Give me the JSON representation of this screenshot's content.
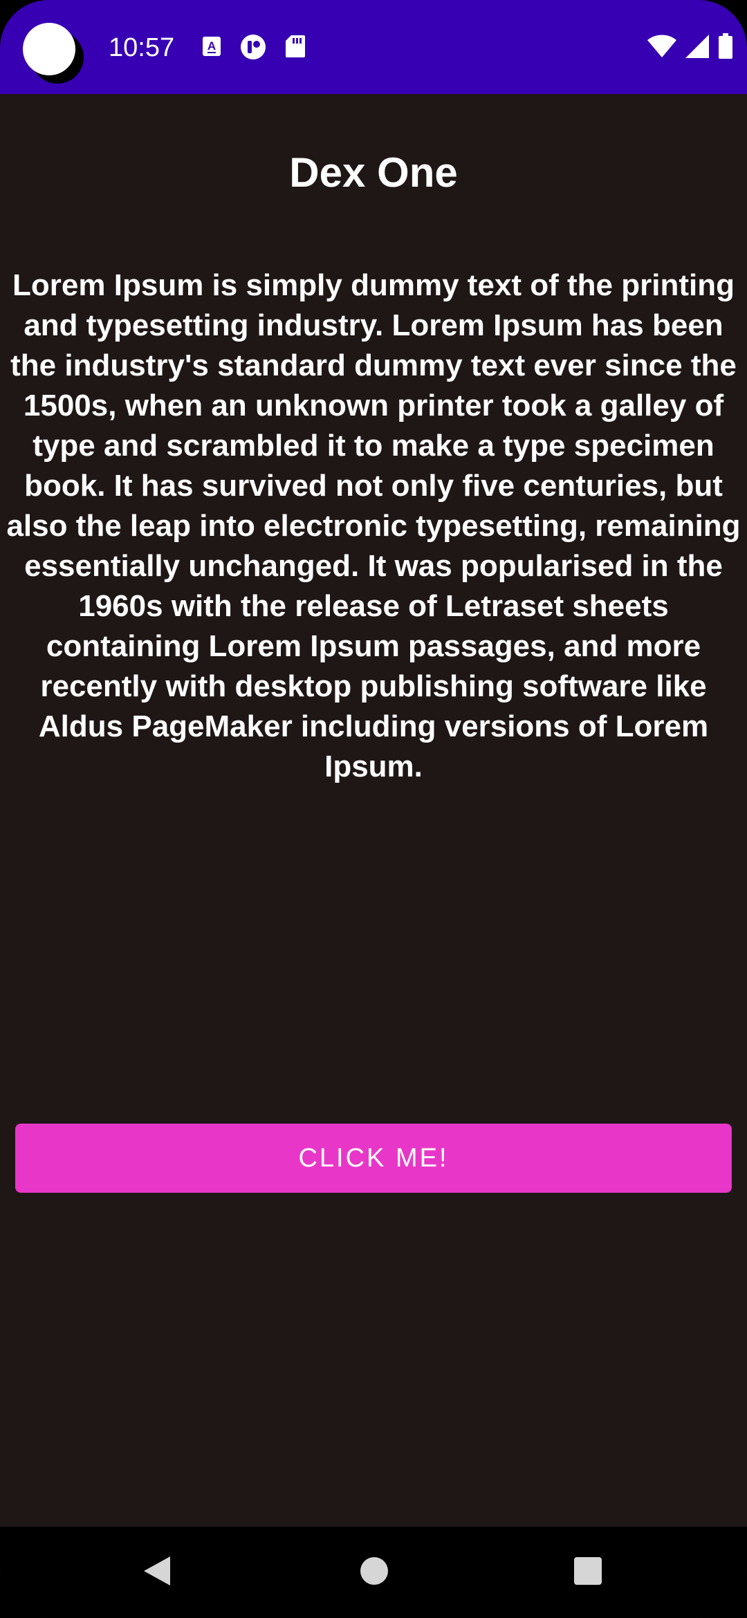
{
  "status_bar": {
    "time": "10:57",
    "background_color": "#3700b3",
    "icons": [
      "a-notification-icon",
      "accessibility-notification-icon",
      "sd-card-icon",
      "wifi-icon",
      "cell-signal-icon",
      "battery-icon"
    ]
  },
  "screen": {
    "title": "Dex One",
    "body": "Lorem Ipsum is simply dummy text of the printing and typesetting industry. Lorem Ipsum has been the industry's standard dummy text ever since the 1500s, when an unknown printer took a galley of type and scrambled it to make a type specimen book. It has survived not only five centuries, but also the leap into electronic typesetting, remaining essentially unchanged. It was popularised in the 1960s with the release of Letraset sheets containing Lorem Ipsum passages, and more recently with desktop publishing software like Aldus PageMaker including versions of Lorem Ipsum.",
    "button_label": "CLICK ME!",
    "background_color": "#1f1616",
    "button_color": "#e837c8"
  },
  "nav_bar": {
    "icons": [
      "back-icon",
      "home-icon",
      "recents-icon"
    ]
  }
}
